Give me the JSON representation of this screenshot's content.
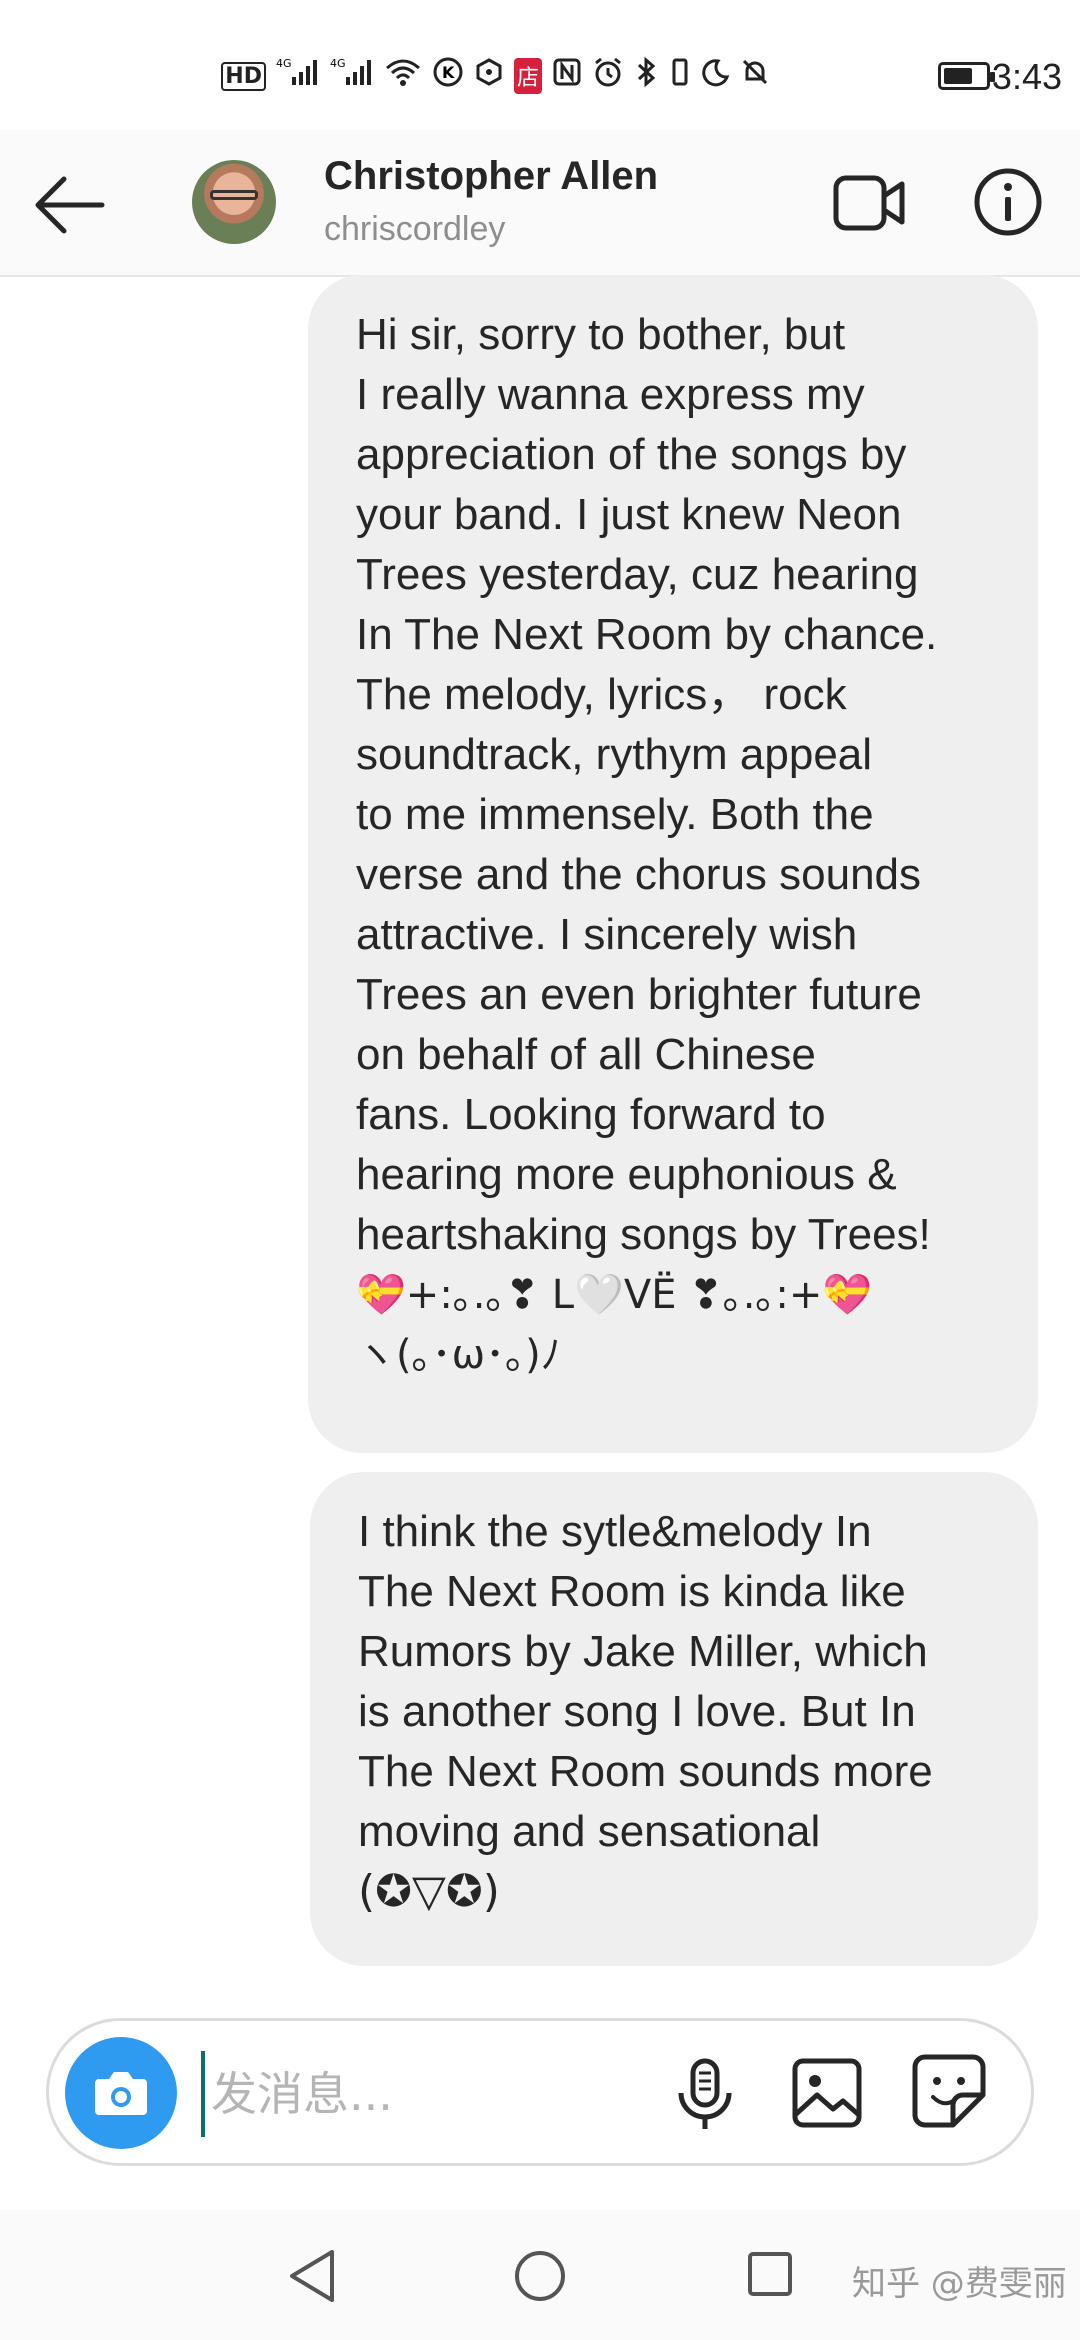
{
  "status_bar": {
    "icons": [
      "HD",
      "4G",
      "4G",
      "wifi",
      "K",
      "hexagon",
      "店",
      "N",
      "alarm",
      "bluetooth",
      "moon",
      "bell-off"
    ],
    "battery_level": 0.7,
    "time": "3:43"
  },
  "header": {
    "name": "Christopher Allen",
    "username": "chriscordley"
  },
  "messages": [
    {
      "lines": [
        "Hi sir, sorry to bother, but",
        "I really wanna express my",
        "appreciation of the songs by",
        "your band. I just knew Neon",
        "Trees yesterday, cuz hearing",
        "In The Next Room by chance.",
        "The melody, lyrics， rock",
        "soundtrack, rythym appeal",
        "to me immensely. Both the",
        "verse and the chorus sounds",
        "attractive. I sincerely wish",
        "Trees an even brighter future",
        "on behalf of all Chinese",
        "fans. Looking forward to",
        "hearing more euphonious &",
        "heartshaking songs by Trees!",
        "💝+:｡.｡❣ L🤍VË ❣｡.｡:+💝",
        "ヽ(｡･ω･｡)ﾉ"
      ]
    },
    {
      "lines": [
        "I think the sytle&melody In",
        "The Next Room is kinda like",
        "Rumors by Jake Miller, which",
        "is another song I love. But In",
        "The Next Room sounds more",
        "moving and sensational",
        "(✪▽✪)"
      ]
    }
  ],
  "composer": {
    "placeholder": "发消息..."
  },
  "watermark": "知乎 @费雯丽"
}
